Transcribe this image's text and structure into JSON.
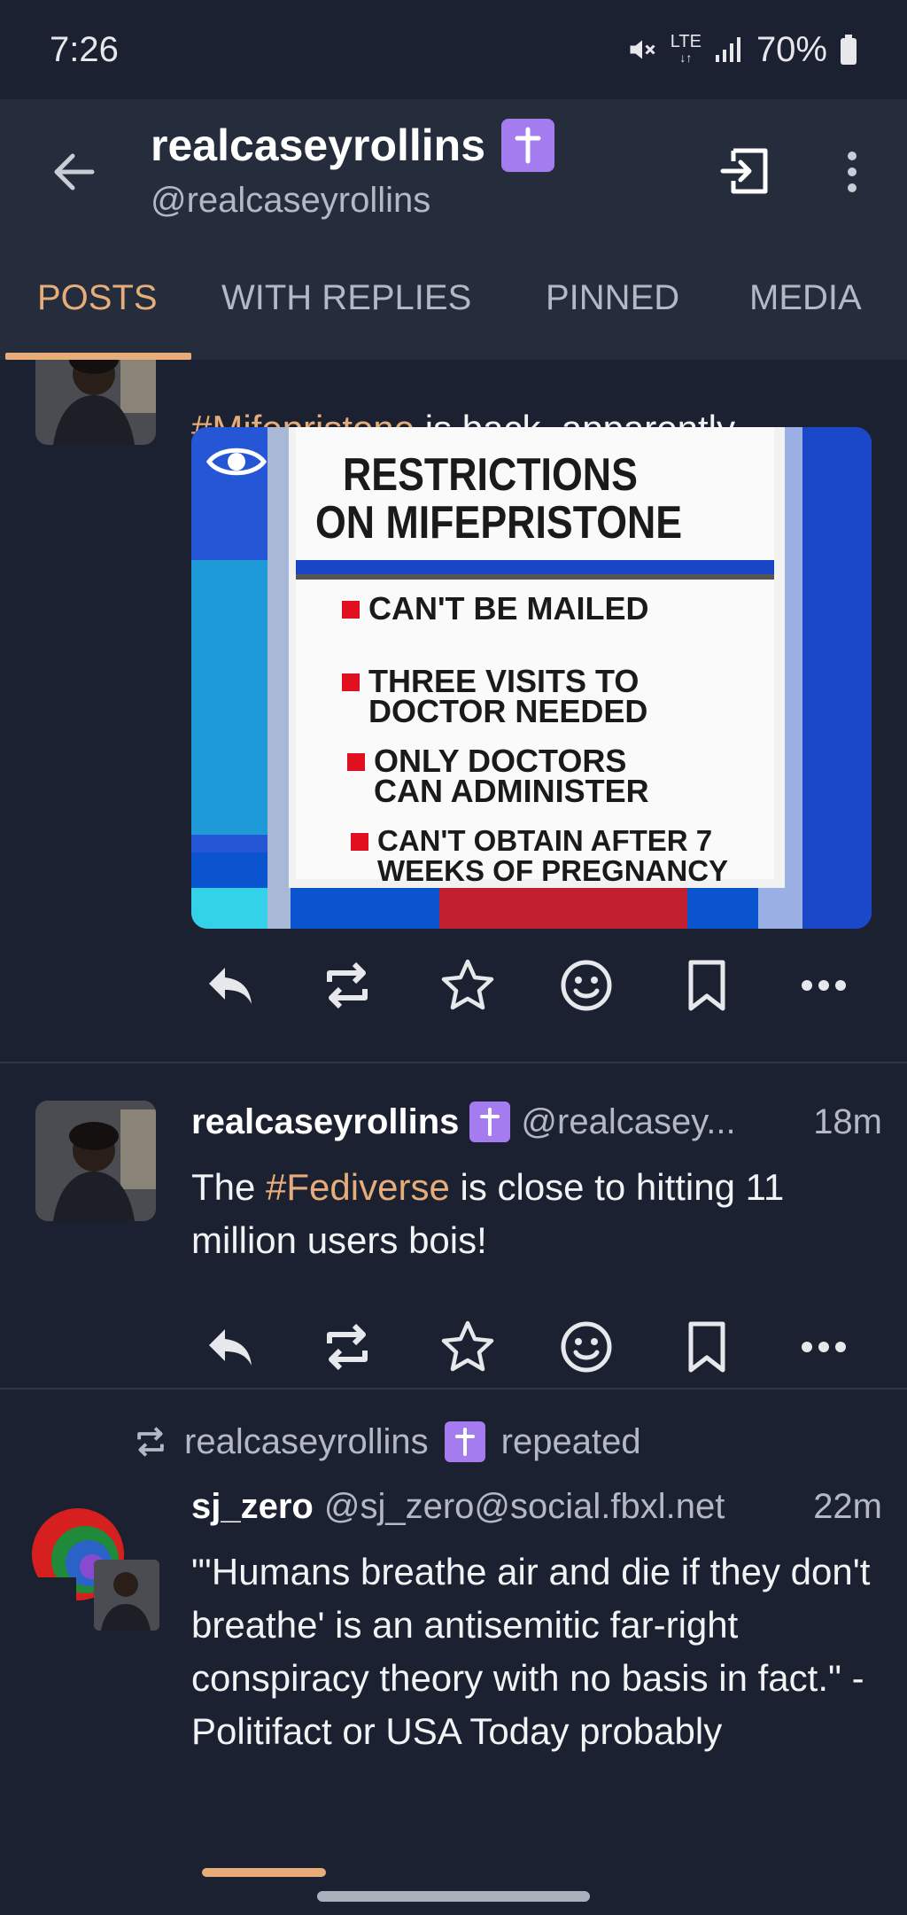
{
  "status_bar": {
    "time": "7:26",
    "network": "LTE",
    "battery": "70%"
  },
  "header": {
    "title": "realcaseyrollins",
    "handle": "@realcaseyrollins",
    "badge": "✝",
    "icons": [
      "back-arrow-icon",
      "logout-icon",
      "more-vertical-icon"
    ]
  },
  "tabs": [
    {
      "label": "POSTS",
      "active": true
    },
    {
      "label": "WITH REPLIES",
      "active": false
    },
    {
      "label": "PINNED",
      "active": false
    },
    {
      "label": "MEDIA",
      "active": false
    }
  ],
  "posts": [
    {
      "text_hashtag": "#Mifepristone",
      "text_rest": " is back, apparently",
      "media": {
        "title_line1": "RESTRICTIONS",
        "title_line2": "ON MIFEPRISTONE",
        "items": [
          [
            "CAN'T BE MAILED"
          ],
          [
            "THREE VISITS TO",
            "DOCTOR NEEDED"
          ],
          [
            "ONLY DOCTORS",
            "CAN ADMINISTER"
          ],
          [
            "CAN'T OBTAIN AFTER 7",
            "WEEKS OF PREGNANCY"
          ]
        ]
      }
    },
    {
      "name": "realcaseyrollins",
      "badge": "✝",
      "handle": "@realcasey...",
      "time": "18m",
      "text_before": "The ",
      "text_hashtag": "#Fediverse",
      "text_after": " is close to hitting 11 million users bois!"
    },
    {
      "repeated_by": "realcaseyrollins",
      "repeated_badge": "✝",
      "repeated_label": "repeated",
      "name": "sj_zero",
      "handle": "@sj_zero@social.fbxl.net",
      "time": "22m",
      "text": "\"'Humans breathe air and die if they don't breathe' is an antisemitic far-right conspiracy theory with no basis in fact.\" - Politifact or USA Today probably"
    }
  ],
  "colors": {
    "background": "#1b2130",
    "header": "#252c3c",
    "accent": "#e6ad7a",
    "badge": "#a47cf0"
  }
}
